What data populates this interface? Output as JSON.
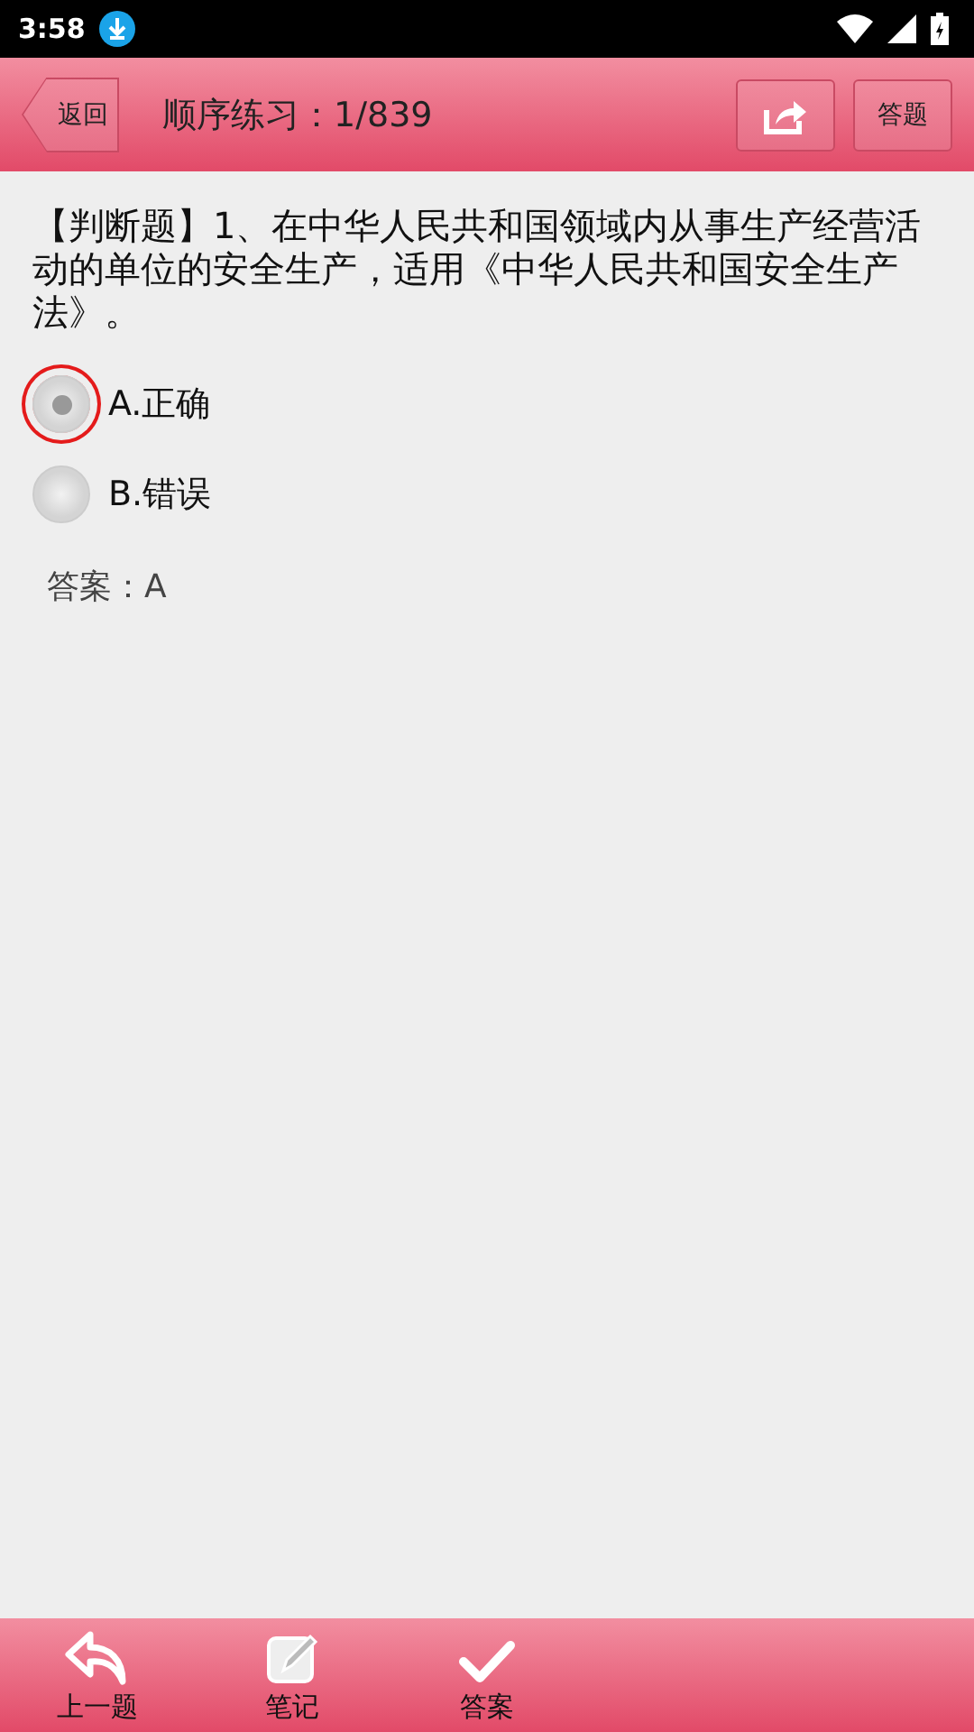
{
  "status_bar": {
    "time": "3:58"
  },
  "header": {
    "back": "返回",
    "title": "顺序练习：1/839",
    "answer_button": "答题"
  },
  "question": {
    "text": "【判断题】1、在中华人民共和国领域内从事生产经营活动的单位的安全生产，适用《中华人民共和国安全生产法》。",
    "options": [
      {
        "label": "A.正确",
        "selected": true
      },
      {
        "label": "B.错误",
        "selected": false
      }
    ],
    "answer": "答案：A"
  },
  "bottom_bar": [
    {
      "kind": "back",
      "label": "上一题"
    },
    {
      "kind": "note",
      "label": "笔记"
    },
    {
      "kind": "check",
      "label": "答案"
    }
  ]
}
